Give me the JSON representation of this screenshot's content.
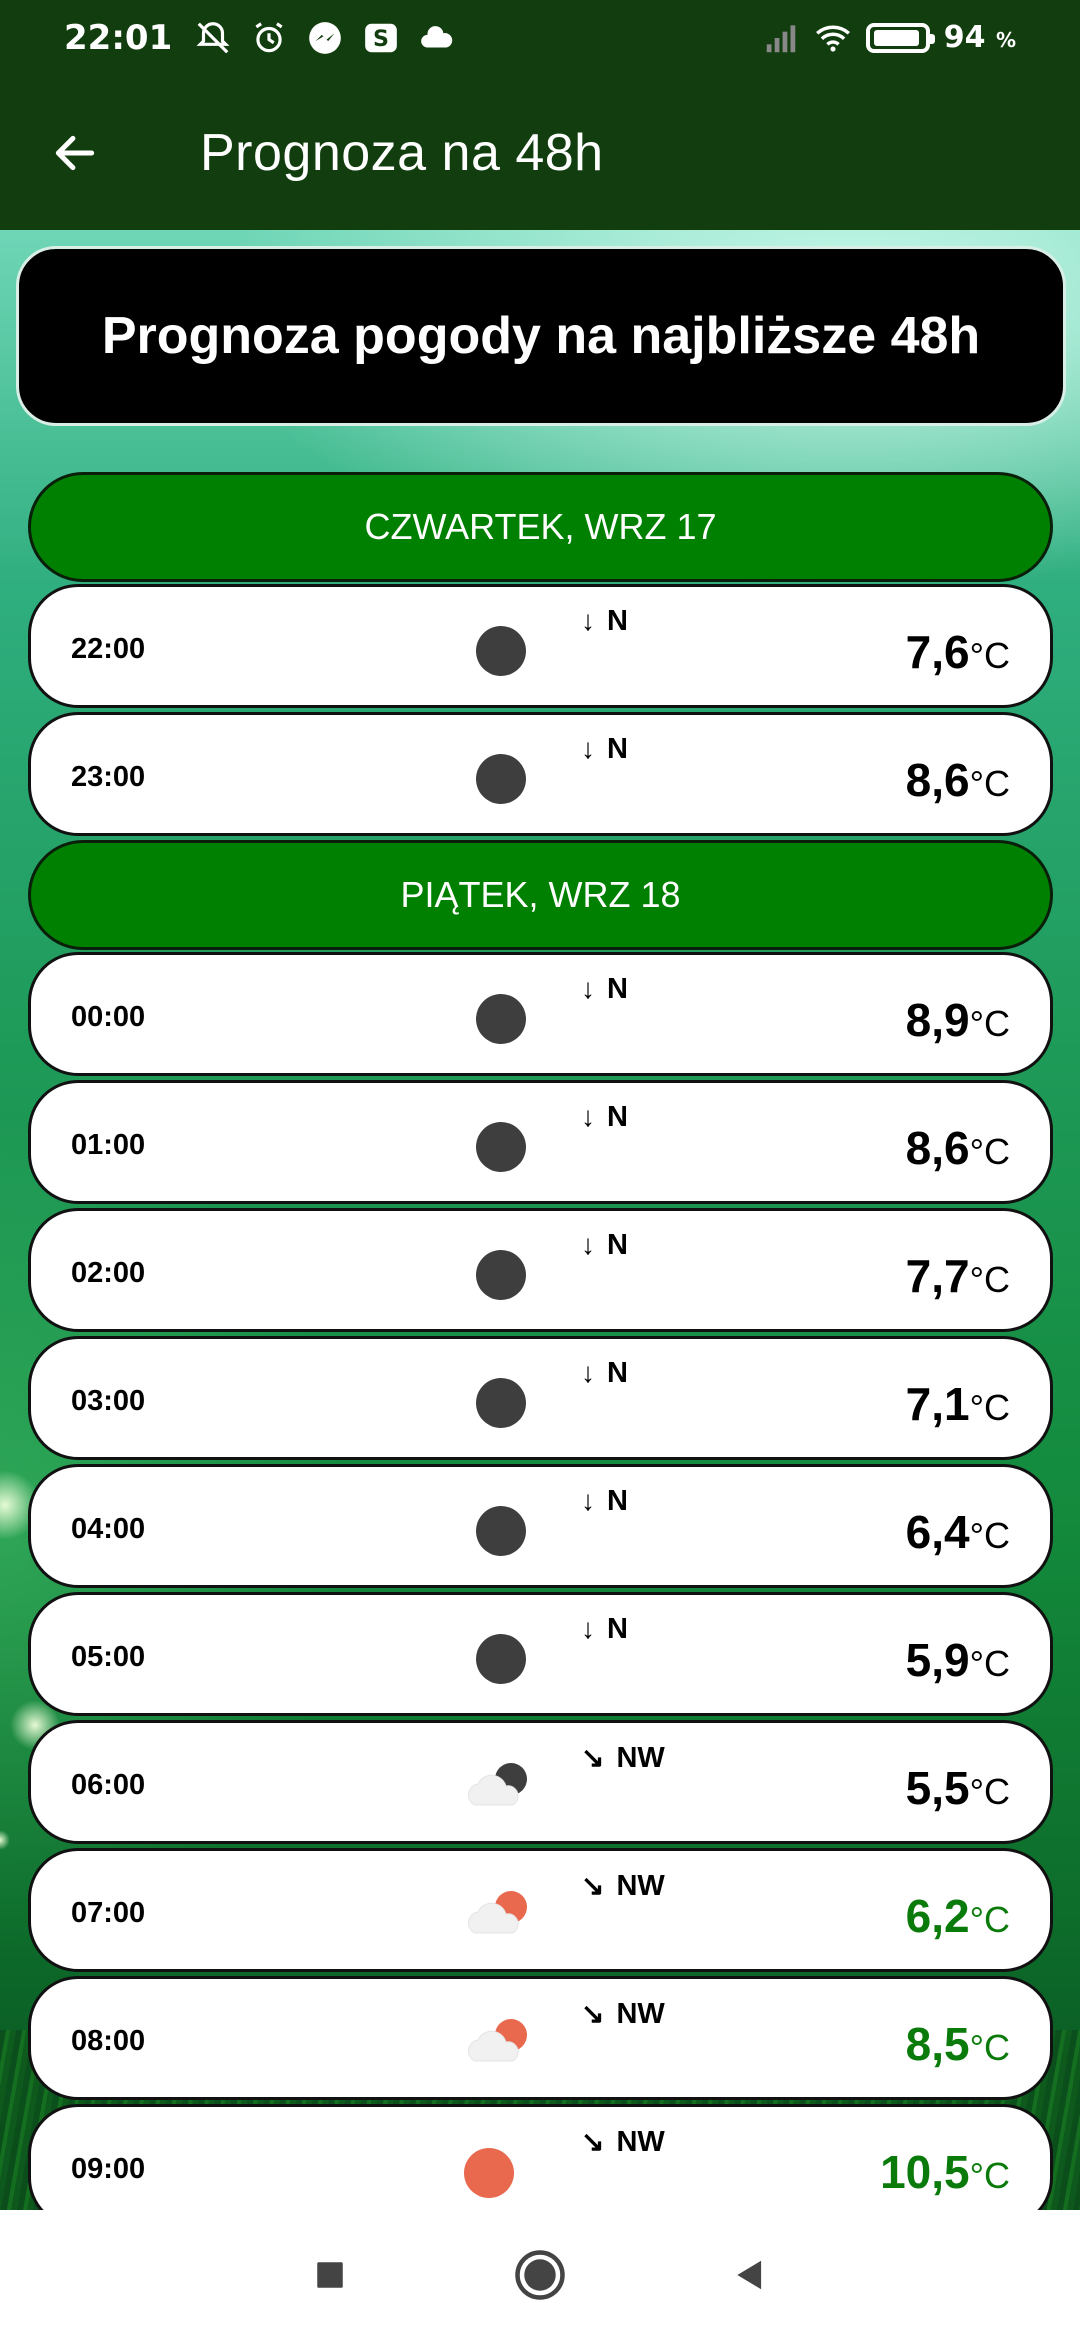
{
  "status_bar": {
    "time": "22:01",
    "battery_percent": "94",
    "battery_unit": "%"
  },
  "app_bar": {
    "title": "Prognoza na 48h"
  },
  "header_card": {
    "title": "Prognoza pogody na najbliższe 48h"
  },
  "colors": {
    "app_bar": "#123d0f",
    "day_header": "#008000",
    "warm_temp": "#0a7a0a",
    "sun": "#e8694e",
    "moon": "#3e3e3e"
  },
  "days": [
    {
      "label": "CZWARTEK, WRZ 17",
      "hours": [
        {
          "time": "22:00",
          "icon": "moon-icon",
          "wind_arrow": "↓",
          "wind_dir": "N",
          "temp": "7,6",
          "unit": "°C",
          "warm": false
        },
        {
          "time": "23:00",
          "icon": "moon-icon",
          "wind_arrow": "↓",
          "wind_dir": "N",
          "temp": "8,6",
          "unit": "°C",
          "warm": false
        }
      ]
    },
    {
      "label": "PIĄTEK, WRZ 18",
      "hours": [
        {
          "time": "00:00",
          "icon": "moon-icon",
          "wind_arrow": "↓",
          "wind_dir": "N",
          "temp": "8,9",
          "unit": "°C",
          "warm": false
        },
        {
          "time": "01:00",
          "icon": "moon-icon",
          "wind_arrow": "↓",
          "wind_dir": "N",
          "temp": "8,6",
          "unit": "°C",
          "warm": false
        },
        {
          "time": "02:00",
          "icon": "moon-icon",
          "wind_arrow": "↓",
          "wind_dir": "N",
          "temp": "7,7",
          "unit": "°C",
          "warm": false
        },
        {
          "time": "03:00",
          "icon": "moon-icon",
          "wind_arrow": "↓",
          "wind_dir": "N",
          "temp": "7,1",
          "unit": "°C",
          "warm": false
        },
        {
          "time": "04:00",
          "icon": "moon-icon",
          "wind_arrow": "↓",
          "wind_dir": "N",
          "temp": "6,4",
          "unit": "°C",
          "warm": false
        },
        {
          "time": "05:00",
          "icon": "moon-icon",
          "wind_arrow": "↓",
          "wind_dir": "N",
          "temp": "5,9",
          "unit": "°C",
          "warm": false
        },
        {
          "time": "06:00",
          "icon": "cloud-moon-icon",
          "wind_arrow": "↘",
          "wind_dir": "NW",
          "temp": "5,5",
          "unit": "°C",
          "warm": false
        },
        {
          "time": "07:00",
          "icon": "cloud-sun-icon",
          "wind_arrow": "↘",
          "wind_dir": "NW",
          "temp": "6,2",
          "unit": "°C",
          "warm": true
        },
        {
          "time": "08:00",
          "icon": "cloud-sun-icon",
          "wind_arrow": "↘",
          "wind_dir": "NW",
          "temp": "8,5",
          "unit": "°C",
          "warm": true
        },
        {
          "time": "09:00",
          "icon": "sun-icon",
          "wind_arrow": "↘",
          "wind_dir": "NW",
          "temp": "10,5",
          "unit": "°C",
          "warm": true
        }
      ]
    }
  ]
}
